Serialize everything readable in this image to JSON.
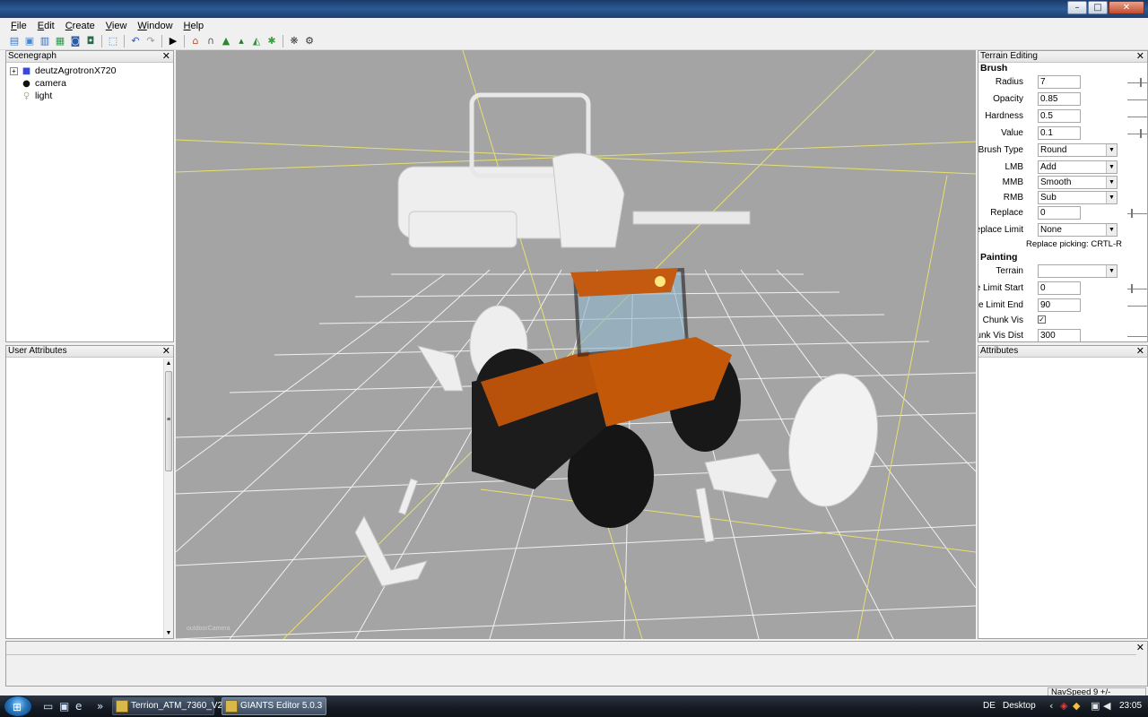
{
  "window": {
    "minimize": "–",
    "maximize": "□",
    "close": "✕"
  },
  "menu": [
    {
      "label": "File",
      "accel": "F",
      "rest": "ile"
    },
    {
      "label": "Edit",
      "accel": "E",
      "rest": "dit"
    },
    {
      "label": "Create",
      "accel": "C",
      "rest": "reate"
    },
    {
      "label": "View",
      "accel": "V",
      "rest": "iew"
    },
    {
      "label": "Window",
      "accel": "W",
      "rest": "indow"
    },
    {
      "label": "Help",
      "accel": "H",
      "rest": "elp"
    }
  ],
  "toolbar": {
    "icons": [
      "new-file-icon",
      "open-folder-icon",
      "import-icon",
      "refresh-icon",
      "save-icon",
      "save-all-icon",
      "select-icon",
      "undo-icon",
      "redo-icon",
      "play-icon",
      "home-icon",
      "magnet-icon",
      "terrain-raise-icon",
      "terrain-paint-icon",
      "terrain-smooth-icon",
      "foliage-icon",
      "particle-icon",
      "settings-icon"
    ]
  },
  "scenegraph": {
    "title": "Scenegraph",
    "items": [
      {
        "label": "deutzAgrotronX720",
        "icon": "cube-icon",
        "expand": "+"
      },
      {
        "label": "camera",
        "icon": "camera-icon"
      },
      {
        "label": "light",
        "icon": "light-bulb-icon"
      }
    ]
  },
  "user_attributes": {
    "title": "User Attributes"
  },
  "viewport": {
    "camera_label": "outdoorCamera"
  },
  "terrain_editing": {
    "title": "Terrain Editing",
    "brush_title": "Brush",
    "radius": {
      "label": "Radius",
      "value": "7"
    },
    "opacity": {
      "label": "Opacity",
      "value": "0.85"
    },
    "hardness": {
      "label": "Hardness",
      "value": "0.5"
    },
    "value": {
      "label": "Value",
      "value": "0.1"
    },
    "brush_type": {
      "label": "Brush Type",
      "value": "Round"
    },
    "lmb": {
      "label": "LMB",
      "value": "Add"
    },
    "mmb": {
      "label": "MMB",
      "value": "Smooth"
    },
    "rmb": {
      "label": "RMB",
      "value": "Sub"
    },
    "replace": {
      "label": "Replace",
      "value": "0"
    },
    "replace_limit": {
      "label": "Replace Limit",
      "value": "None"
    },
    "replace_picking": "Replace picking: CRTL-R",
    "painting_title": "Painting",
    "terrain": {
      "label": "Terrain",
      "value": ""
    },
    "slope_start": {
      "label": "Slope Limit Start",
      "value": "0"
    },
    "slope_end": {
      "label": "Slope Limit End",
      "value": "90"
    },
    "chunk_vis": {
      "label": "Chunk Vis",
      "checked": "✓"
    },
    "chunk_vis_dist": {
      "label": "Chunk Vis Dist",
      "value": "300"
    }
  },
  "attributes": {
    "title": "Attributes"
  },
  "status": {
    "navspeed": "NavSpeed 9 +/-"
  },
  "taskbar": {
    "tasks": [
      {
        "label": "Terrion_ATM_7360_V2",
        "active": false
      },
      {
        "label": "GIANTS Editor 5.0.3 ...",
        "active": true
      }
    ],
    "language": "DE",
    "desktop": "Desktop",
    "clock": "23:05"
  }
}
